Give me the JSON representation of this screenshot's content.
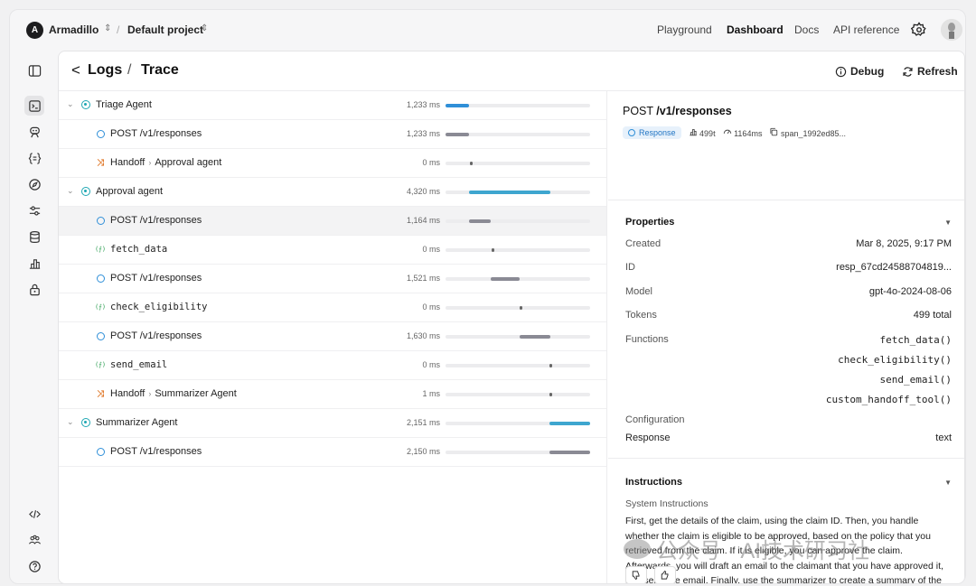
{
  "topbar": {
    "org_initial": "A",
    "org_name": "Armadillo",
    "project_name": "Default project",
    "nav": [
      {
        "label": "Playground",
        "active": false
      },
      {
        "label": "Dashboard",
        "active": true
      },
      {
        "label": "Docs",
        "active": false
      },
      {
        "label": "API reference",
        "active": false
      }
    ]
  },
  "sidebar": {
    "icons": [
      "sidebar-toggle-icon",
      "logs-icon",
      "assistants-icon",
      "functions-icon",
      "compass-icon",
      "sliders-icon",
      "database-icon",
      "usage-icon",
      "lock-icon"
    ],
    "bottom_icons": [
      "code-icon",
      "team-icon",
      "help-icon"
    ]
  },
  "header": {
    "back": "<",
    "crumb_logs": "Logs",
    "crumb_sep": "/",
    "crumb_trace": "Trace",
    "debug_label": "Debug",
    "refresh_label": "Refresh"
  },
  "trace": {
    "rows": [
      {
        "kind": "agent",
        "label": "Triage Agent",
        "duration": "1,233 ms",
        "bar_start": 0.0,
        "bar_end": 0.16,
        "color": "#2f8fd8",
        "collapsible": true
      },
      {
        "kind": "response",
        "label": "POST /v1/responses",
        "duration": "1,233 ms",
        "bar_start": 0.0,
        "bar_end": 0.16,
        "color": "#8a8a94"
      },
      {
        "kind": "handoff",
        "label": "Handoff",
        "target": "Approval agent",
        "duration": "0 ms",
        "bar_start": 0.17,
        "bar_end": 0.19,
        "color": "#666"
      },
      {
        "kind": "agent",
        "label": "Approval agent",
        "duration": "4,320 ms",
        "bar_start": 0.16,
        "bar_end": 0.72,
        "color": "#3ea6cf",
        "collapsible": true
      },
      {
        "kind": "response",
        "label": "POST /v1/responses",
        "duration": "1,164 ms",
        "bar_start": 0.16,
        "bar_end": 0.31,
        "color": "#8a8a94",
        "selected": true
      },
      {
        "kind": "function",
        "label": "fetch_data",
        "duration": "0 ms",
        "bar_start": 0.32,
        "bar_end": 0.34,
        "color": "#666"
      },
      {
        "kind": "response",
        "label": "POST /v1/responses",
        "duration": "1,521 ms",
        "bar_start": 0.31,
        "bar_end": 0.51,
        "color": "#8a8a94"
      },
      {
        "kind": "function",
        "label": "check_eligibility",
        "duration": "0 ms",
        "bar_start": 0.51,
        "bar_end": 0.53,
        "color": "#666"
      },
      {
        "kind": "response",
        "label": "POST /v1/responses",
        "duration": "1,630 ms",
        "bar_start": 0.51,
        "bar_end": 0.72,
        "color": "#8a8a94"
      },
      {
        "kind": "function",
        "label": "send_email",
        "duration": "0 ms",
        "bar_start": 0.72,
        "bar_end": 0.74,
        "color": "#666"
      },
      {
        "kind": "handoff",
        "label": "Handoff",
        "target": "Summarizer Agent",
        "duration": "1 ms",
        "bar_start": 0.72,
        "bar_end": 0.74,
        "color": "#666"
      },
      {
        "kind": "agent",
        "label": "Summarizer Agent",
        "duration": "2,151 ms",
        "bar_start": 0.72,
        "bar_end": 1.0,
        "color": "#3ea6cf",
        "collapsible": true
      },
      {
        "kind": "response",
        "label": "POST /v1/responses",
        "duration": "2,150 ms",
        "bar_start": 0.72,
        "bar_end": 1.0,
        "color": "#8a8a94"
      }
    ]
  },
  "details": {
    "method": "POST",
    "path": "/v1/responses",
    "badge": "Response",
    "tokens": "499t",
    "latency": "1164ms",
    "span": "span_1992ed85...",
    "properties_title": "Properties",
    "props": {
      "created_k": "Created",
      "created_v": "Mar 8, 2025, 9:17 PM",
      "id_k": "ID",
      "id_v": "resp_67cd24588704819...",
      "model_k": "Model",
      "model_v": "gpt-4o-2024-08-06",
      "tokens_k": "Tokens",
      "tokens_v": "499 total",
      "functions_k": "Functions",
      "functions": [
        "fetch_data()",
        "check_eligibility()",
        "send_email()",
        "custom_handoff_tool()"
      ],
      "config_k": "Configuration",
      "response_k": "Response",
      "response_v": "text"
    },
    "instructions_title": "Instructions",
    "instructions_sub": "System Instructions",
    "instructions_body": "First, get the details of the claim, using the claim ID. Then, you handle whether the claim is eligible to be approved, based on the policy that you retrieved from the claim. If it is eligible, you can approve the claim. Afterwards, you will draft an email to the claimant that you have approved it, and send the email. Finally, use the summarizer to create a summary of the claim and how you handled the decision."
  },
  "watermark": "公众号 · AI技术研习社"
}
